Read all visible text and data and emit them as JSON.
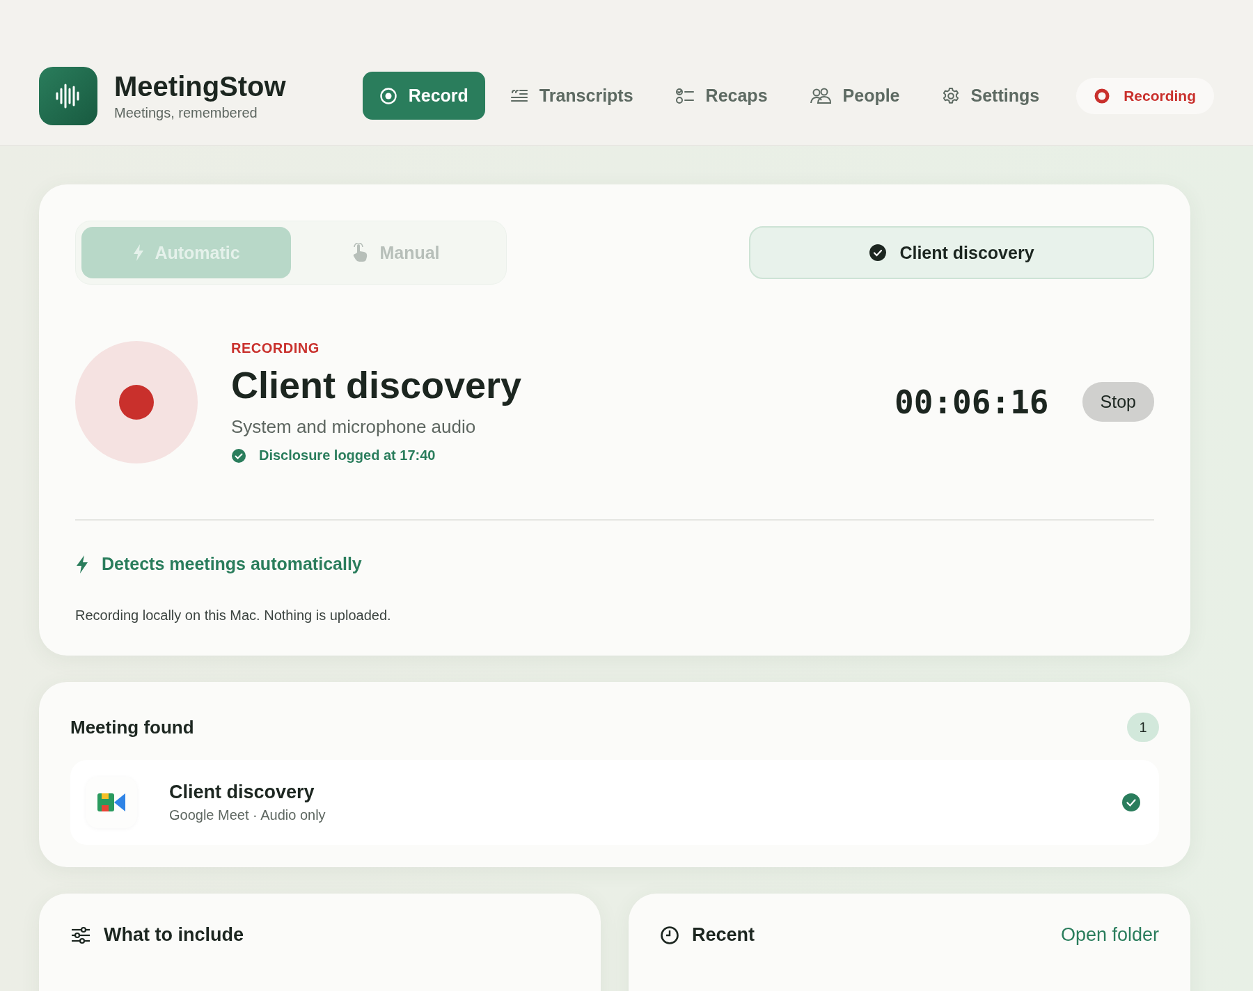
{
  "app": {
    "name": "MeetingStow",
    "tagline": "Meetings, remembered"
  },
  "nav": [
    {
      "label": "Record",
      "kind": "record",
      "selected": true
    },
    {
      "label": "Transcripts",
      "kind": "transcripts",
      "selected": false
    },
    {
      "label": "Recaps",
      "kind": "recaps",
      "selected": false
    },
    {
      "label": "People",
      "kind": "people",
      "selected": false
    },
    {
      "label": "Settings",
      "kind": "settings",
      "selected": false
    }
  ],
  "status_pill": {
    "label": "Recording",
    "recording": true
  },
  "recorder": {
    "mode_toggle": {
      "disabled": true,
      "options": [
        {
          "label": "Automatic",
          "kind": "automatic",
          "selected": true
        },
        {
          "label": "Manual",
          "kind": "manual",
          "selected": false
        }
      ]
    },
    "meeting_chip": {
      "label": "Client discovery",
      "checked": true
    },
    "status_label": "RECORDING",
    "recording": true,
    "title": "Client discovery",
    "source": "System and microphone audio",
    "disclosure": {
      "text": "Disclosure logged at 17:40",
      "checked": true
    },
    "timer": "00:06:16",
    "stop_button": "Stop",
    "auto_detect": "Detects meetings automatically",
    "note": "Recording locally on this Mac. Nothing is uploaded."
  },
  "meeting_found": {
    "title": "Meeting found",
    "count": "1",
    "items": [
      {
        "title": "Client discovery",
        "subtitle": "Google Meet · Audio only",
        "checked": true
      }
    ]
  },
  "include_panel": {
    "title": "What to include"
  },
  "recent_panel": {
    "title": "Recent",
    "link": "Open folder"
  }
}
